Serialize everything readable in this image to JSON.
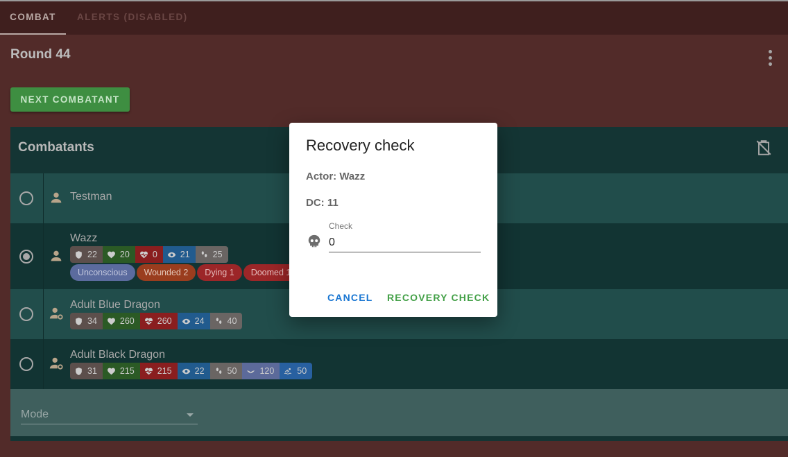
{
  "tabs": [
    {
      "label": "Combat",
      "active": true
    },
    {
      "label": "Alerts (disabled)",
      "active": false
    }
  ],
  "round": {
    "title": "Round 44",
    "menu_icon": "dots-vertical-icon"
  },
  "next_button": {
    "label": "Next combatant",
    "color": "#3e8e41"
  },
  "combatants_card": {
    "title": "Combatants",
    "clipboard_icon": "clipboard-off-icon",
    "rows": [
      {
        "name": "Testman",
        "selected": false,
        "icon": "person-icon"
      },
      {
        "name": "Wazz",
        "selected": true,
        "icon": "person-icon",
        "stats": {
          "ac": "22",
          "max_hp": "20",
          "hp": "0",
          "perception": "21",
          "speed": "25"
        },
        "conditions": [
          "Unconscious",
          "Wounded 2",
          "Dying 1",
          "Doomed 1"
        ]
      },
      {
        "name": "Adult Blue Dragon",
        "selected": false,
        "icon": "person-gear-icon",
        "stats": {
          "ac": "34",
          "max_hp": "260",
          "hp": "260",
          "perception": "24",
          "speed": "40"
        }
      },
      {
        "name": "Adult Black Dragon",
        "selected": false,
        "icon": "person-gear-icon",
        "stats": {
          "ac": "31",
          "max_hp": "215",
          "hp": "215",
          "perception": "22",
          "speed": "50",
          "fly": "120",
          "swim": "50"
        }
      }
    ],
    "mode": {
      "label": "Mode"
    }
  },
  "dialog": {
    "title": "Recovery check",
    "actor_line": "Actor: Wazz",
    "dc_line": "DC: 11",
    "input_label": "Check",
    "input_value": "0",
    "input_icon": "skull-icon",
    "cancel_label": "Cancel",
    "confirm_label": "Recovery check"
  }
}
